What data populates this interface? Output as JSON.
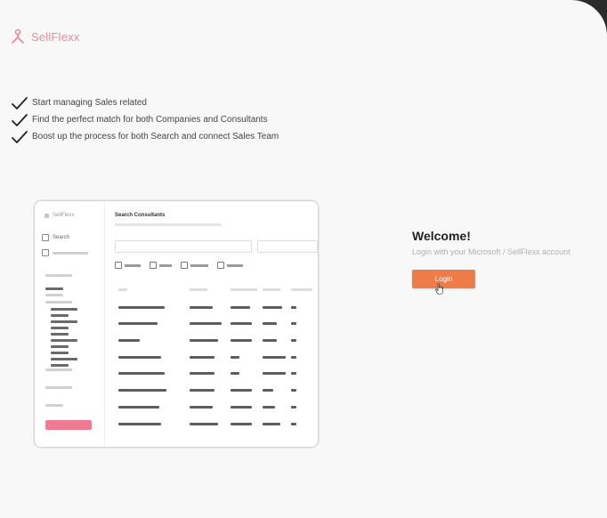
{
  "brand": {
    "name": "SellFlexx"
  },
  "features": [
    {
      "text": "Start managing Sales related"
    },
    {
      "text": "Find the perfect match for both Companies and Consultants"
    },
    {
      "text": "Boost up the process for both Search and connect Sales Team"
    }
  ],
  "preview": {
    "brand": "SellFlexx",
    "nav_item": "Search",
    "page_title": "Search Consultants"
  },
  "auth": {
    "title": "Welcome!",
    "subtitle": "Login with your Microsoft / SellFlexx account",
    "login_label": "Login"
  },
  "colors": {
    "brand_pink": "#ec8a9a",
    "login_orange": "#ee7b4a",
    "background": "#f8f8f9"
  }
}
